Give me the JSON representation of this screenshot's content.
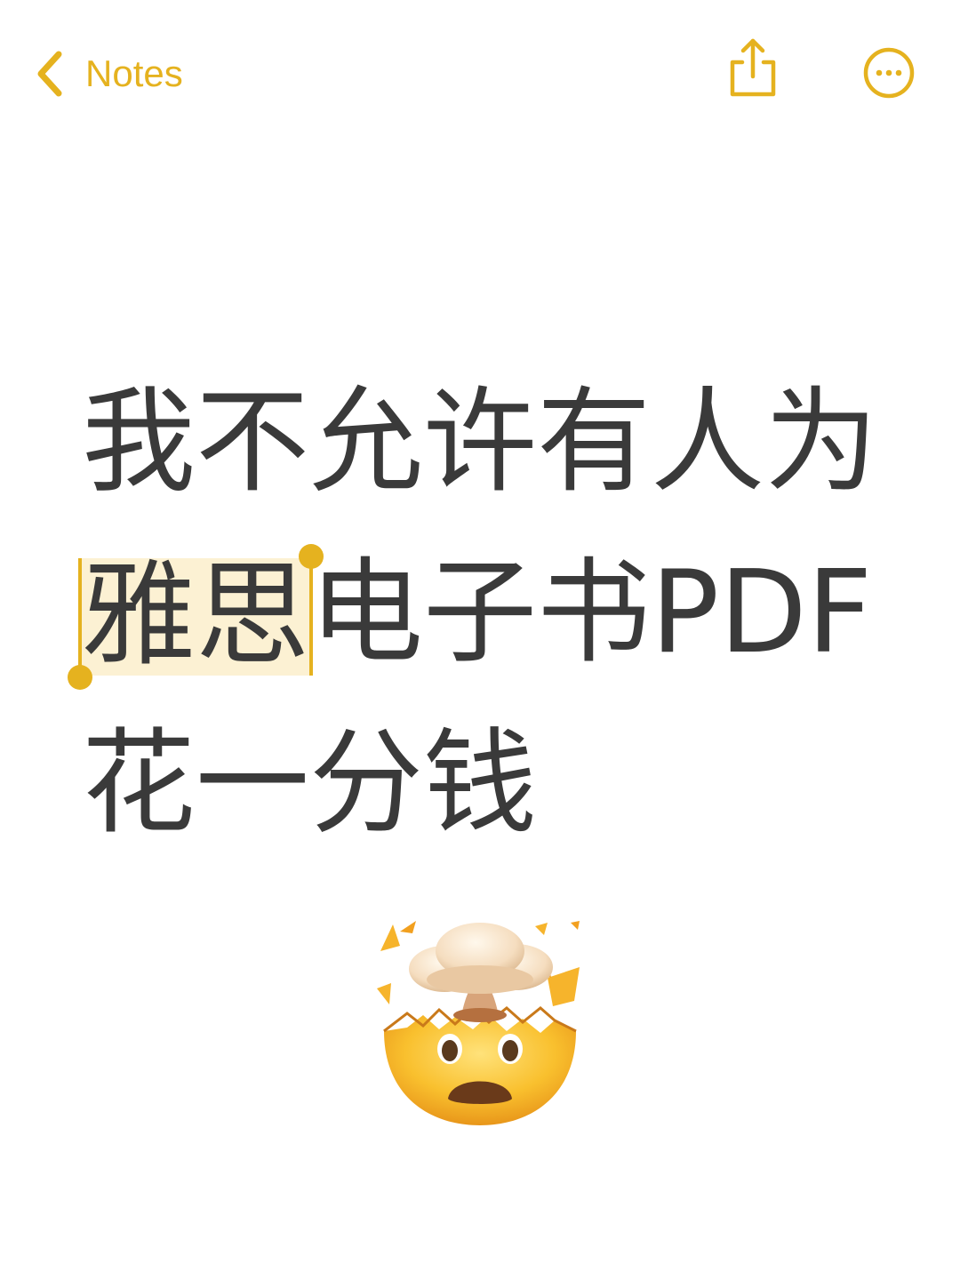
{
  "nav": {
    "back_label": "Notes",
    "accent_color": "#E5B21F",
    "icons": {
      "back": "chevron-left-icon",
      "share": "share-icon",
      "more": "ellipsis-circle-icon"
    }
  },
  "note": {
    "line1": "我不允许有人为",
    "line2_selected": "雅思",
    "line2_rest": "电子书PDF",
    "line3": "花一分钱",
    "text_color": "#3a3a3a",
    "selection_color": "#FCF1D3"
  },
  "emoji": {
    "icon": "exploding-head-icon"
  }
}
